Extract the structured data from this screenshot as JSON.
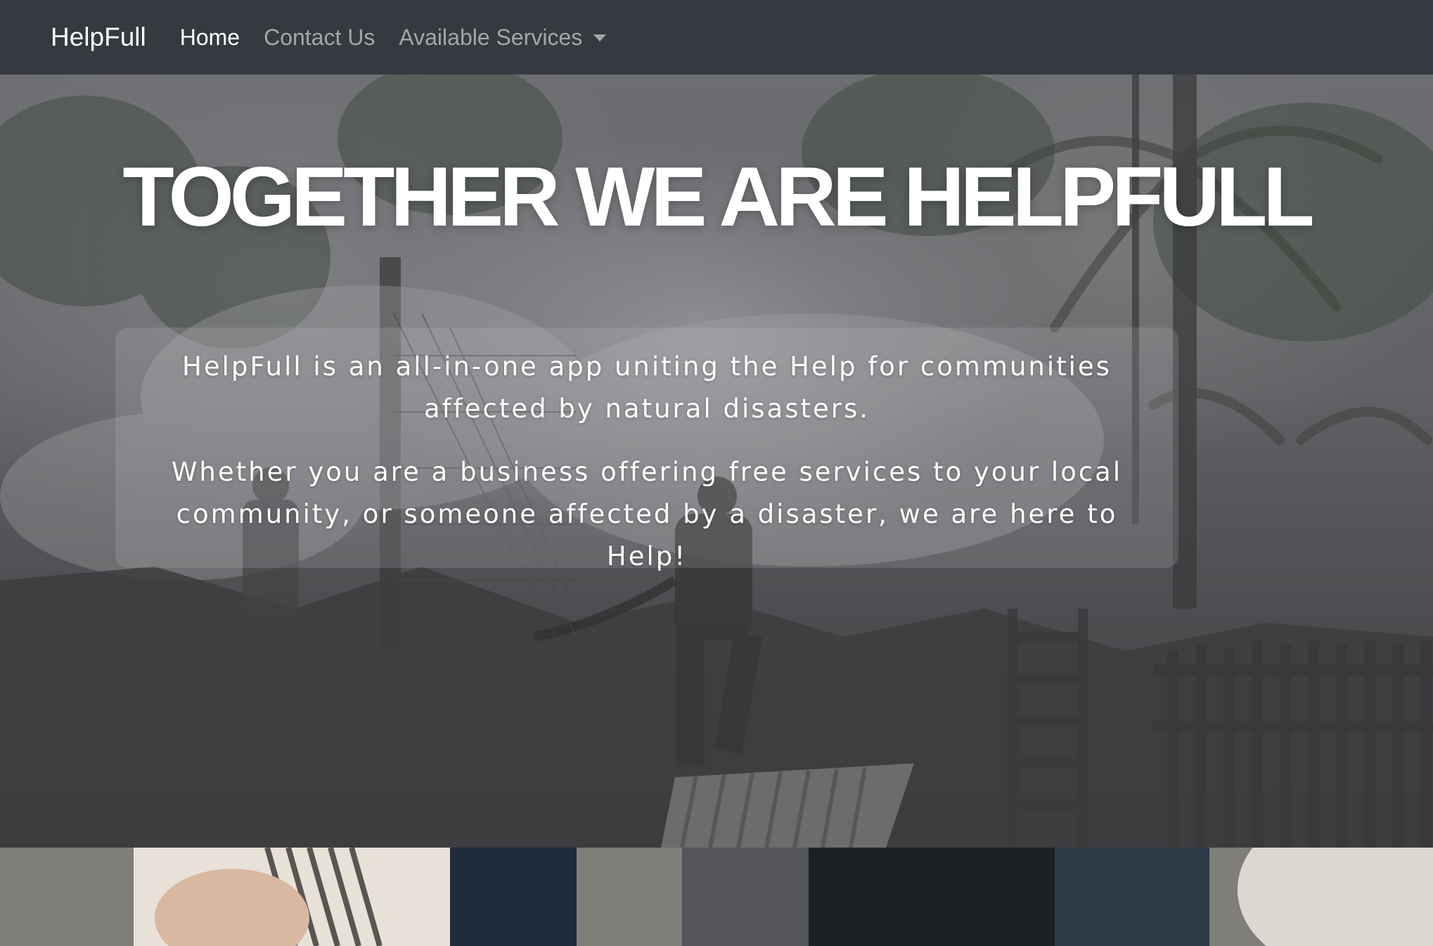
{
  "navbar": {
    "brand": "HelpFull",
    "links": [
      {
        "label": "Home",
        "active": true
      },
      {
        "label": "Contact Us",
        "active": false
      },
      {
        "label": "Available Services",
        "active": false,
        "dropdown": true
      }
    ]
  },
  "hero": {
    "title": "TOGETHER WE ARE HELPFULL",
    "paragraph_1": "HelpFull is an all-in-one app uniting the Help for communities affected by natural disasters.",
    "paragraph_2": "Whether you are a business offering free services to your local community, or someone affected by a disaster, we are here to Help!"
  },
  "colors": {
    "navbar_bg": "#343a40",
    "nav_active": "#ffffff",
    "nav_inactive": "rgba(255,255,255,0.55)"
  }
}
